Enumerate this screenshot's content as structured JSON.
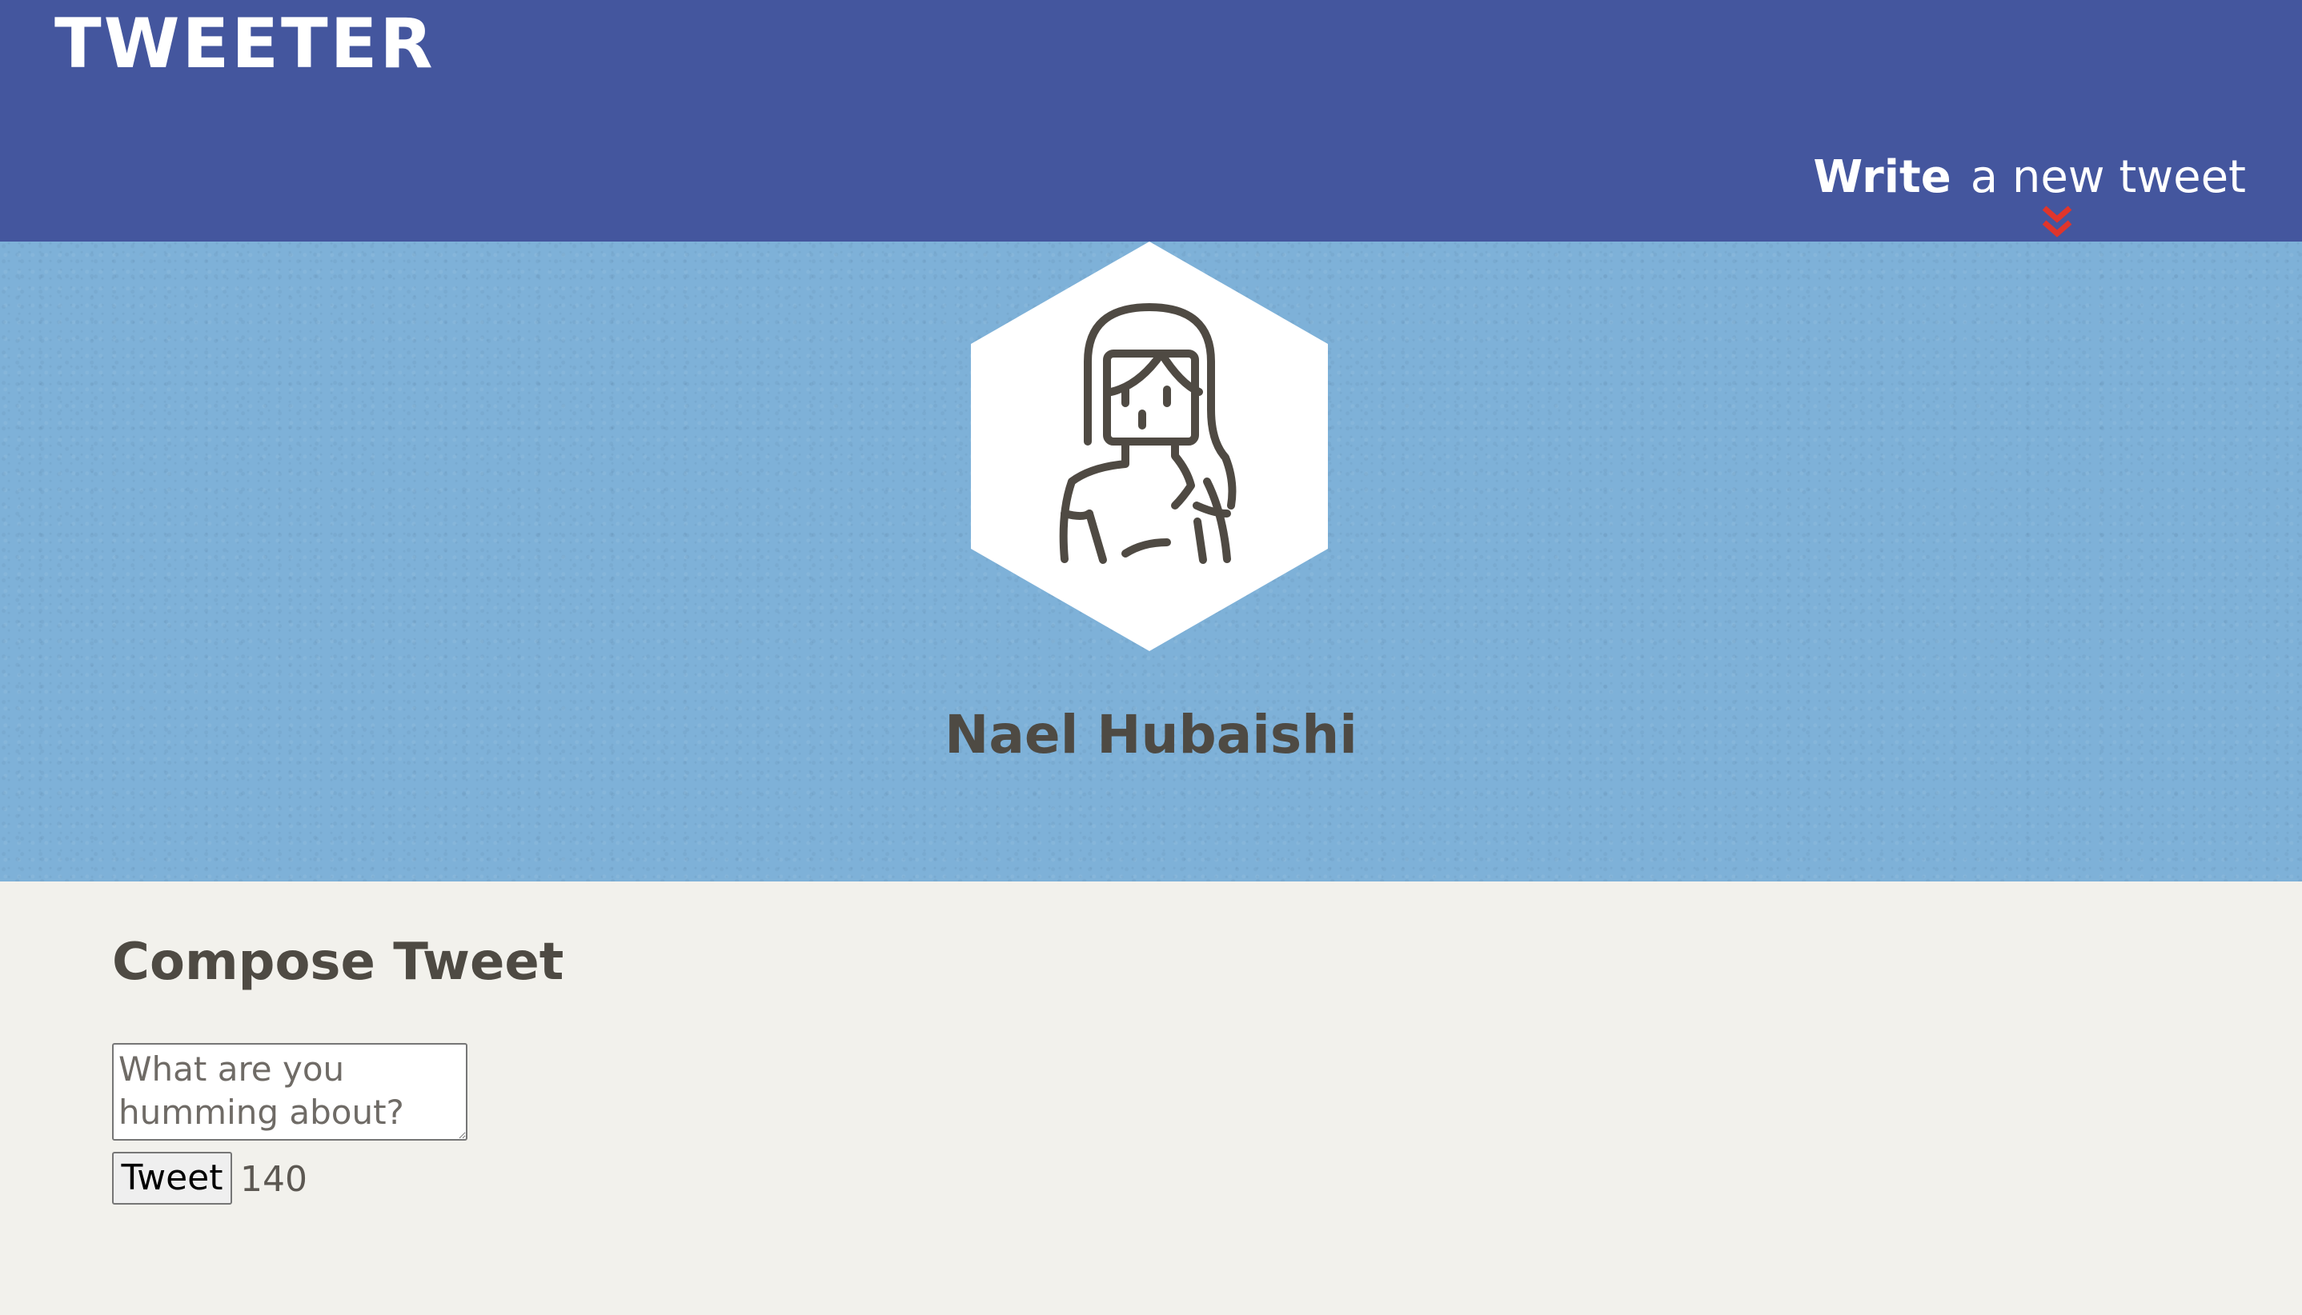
{
  "nav": {
    "brand": "TWEETER",
    "compose_toggle": {
      "strong": "Write",
      "light": "a new tweet"
    },
    "chevron_icon": "double-chevron-down-icon",
    "accent_color": "#e0352b",
    "bg_color": "#44569e"
  },
  "profile": {
    "name": "Nael Hubaishi",
    "avatar_icon": "woman-avatar-icon",
    "banner_color": "#7eb1d8"
  },
  "composer": {
    "heading": "Compose Tweet",
    "textarea_placeholder": "What are you humming about?",
    "submit_label": "Tweet",
    "counter": "140"
  }
}
